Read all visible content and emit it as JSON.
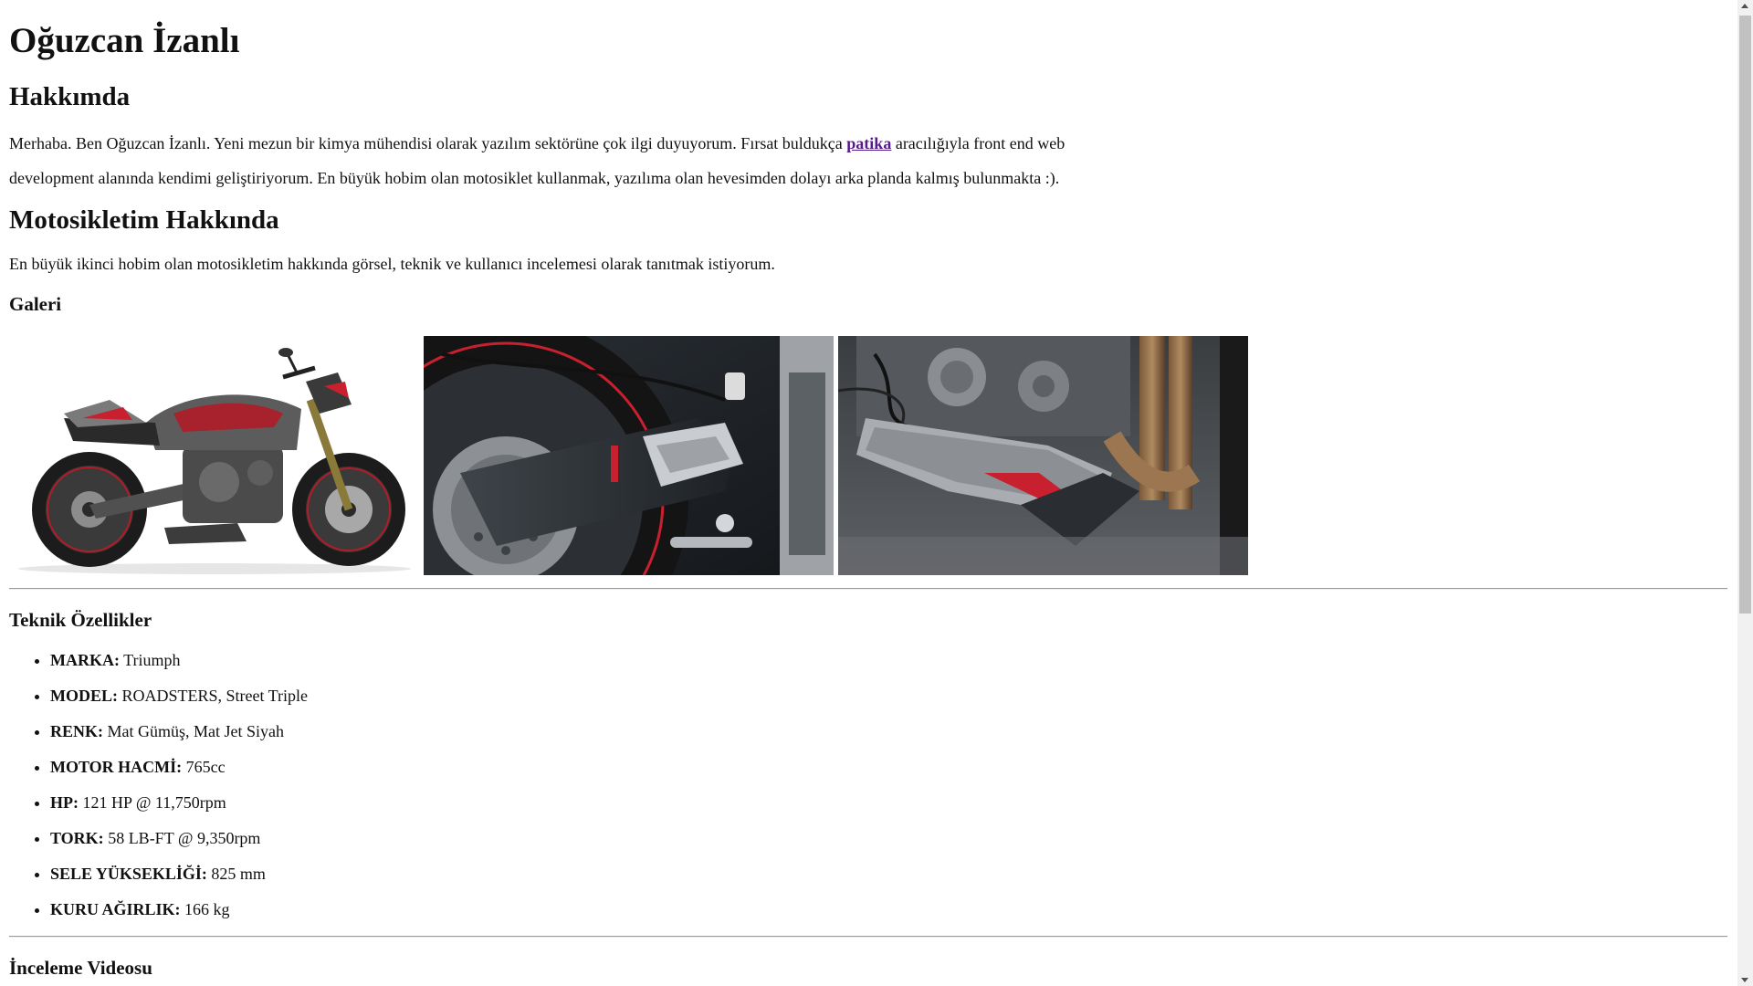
{
  "header": {
    "name": "Oğuzcan İzanlı"
  },
  "about": {
    "heading": "Hakkımda",
    "text_before_link": "Merhaba. Ben Oğuzcan İzanlı. Yeni mezun bir kimya mühendisi olarak yazılım sektörüne çok ilgi duyuyorum. Fırsat buldukça ",
    "link_text": "patika",
    "text_after_link": " aracılığıyla front end web development alanında kendimi geliştiriyorum. En büyük hobim olan motosiklet kullanmak, yazılıma olan hevesimden dolayı arka planda kalmış bulunmakta :)."
  },
  "motorcycle": {
    "heading": "Motosikletim Hakkında",
    "text": "En büyük ikinci hobim olan motosikletim hakkında görsel, teknik ve kullanıcı incelemesi olarak tanıtmak istiyorum."
  },
  "gallery": {
    "heading": "Galeri",
    "images": [
      {
        "name": "motorcycle-side-view-photo"
      },
      {
        "name": "rear-swingarm-closeup-photo"
      },
      {
        "name": "engine-belly-pan-closeup-photo"
      }
    ]
  },
  "specs": {
    "heading": "Teknik Özellikler",
    "items": [
      {
        "label": "MARKA:",
        "value": " Triumph"
      },
      {
        "label": "MODEL:",
        "value": " ROADSTERS, Street Triple"
      },
      {
        "label": "RENK:",
        "value": " Mat Gümüş, Mat Jet Siyah"
      },
      {
        "label": "MOTOR HACMİ:",
        "value": " 765cc"
      },
      {
        "label": "HP:",
        "value": " 121 HP @ 11,750rpm"
      },
      {
        "label": "TORK:",
        "value": " 58 LB-FT @ 9,350rpm"
      },
      {
        "label": "SELE YÜKSEKLİĞİ:",
        "value": " 825 mm"
      },
      {
        "label": "KURU AĞIRLIK:",
        "value": " 166 kg"
      }
    ]
  },
  "video": {
    "heading": "İnceleme Videosu"
  },
  "colors": {
    "link": "#551a8b",
    "text": "#111111",
    "accent_red": "#c8202e"
  }
}
